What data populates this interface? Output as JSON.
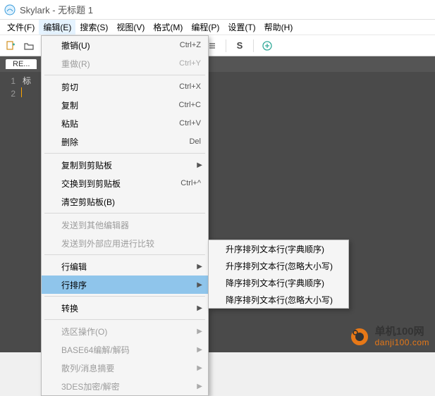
{
  "title": "Skylark - 无标题 1",
  "menubar": [
    "文件(F)",
    "编辑(E)",
    "搜索(S)",
    "视图(V)",
    "格式(M)",
    "编程(P)",
    "设置(T)",
    "帮助(H)"
  ],
  "menubar_open_index": 1,
  "tab_label": "RE...",
  "gutter": [
    "1",
    "2"
  ],
  "content_line1": "标",
  "dropdown": [
    {
      "t": "item",
      "label": "撤销(U)",
      "sc": "Ctrl+Z"
    },
    {
      "t": "item",
      "label": "重做(R)",
      "sc": "Ctrl+Y",
      "disabled": true
    },
    {
      "t": "sep"
    },
    {
      "t": "item",
      "label": "剪切",
      "sc": "Ctrl+X"
    },
    {
      "t": "item",
      "label": "复制",
      "sc": "Ctrl+C"
    },
    {
      "t": "item",
      "label": "粘贴",
      "sc": "Ctrl+V"
    },
    {
      "t": "item",
      "label": "删除",
      "sc": "Del"
    },
    {
      "t": "sep"
    },
    {
      "t": "item",
      "label": "复制到剪贴板",
      "arrow": true
    },
    {
      "t": "item",
      "label": "交换到到剪贴板",
      "sc": "Ctrl+^"
    },
    {
      "t": "item",
      "label": "清空剪贴板(B)"
    },
    {
      "t": "sep"
    },
    {
      "t": "item",
      "label": "发送到其他编辑器",
      "disabled": true
    },
    {
      "t": "item",
      "label": "发送到外部应用进行比较",
      "disabled": true
    },
    {
      "t": "sep"
    },
    {
      "t": "item",
      "label": "行编辑",
      "arrow": true
    },
    {
      "t": "item",
      "label": "行排序",
      "arrow": true,
      "hi": true
    },
    {
      "t": "sep"
    },
    {
      "t": "item",
      "label": "转换",
      "arrow": true
    },
    {
      "t": "sep"
    },
    {
      "t": "item",
      "label": "选区操作(O)",
      "arrow": true,
      "disabled": true
    },
    {
      "t": "item",
      "label": "BASE64编解/解码",
      "arrow": true,
      "disabled": true
    },
    {
      "t": "item",
      "label": "散列/消息摘要",
      "arrow": true,
      "disabled": true
    },
    {
      "t": "item",
      "label": "3DES加密/解密",
      "arrow": true,
      "disabled": true
    }
  ],
  "submenu": [
    "升序排列文本行(字典顺序)",
    "升序排列文本行(忽略大小写)",
    "降序排列文本行(字典顺序)",
    "降序排列文本行(忽略大小写)"
  ],
  "watermark": {
    "line1": "单机100网",
    "line2": "danji100.com"
  }
}
